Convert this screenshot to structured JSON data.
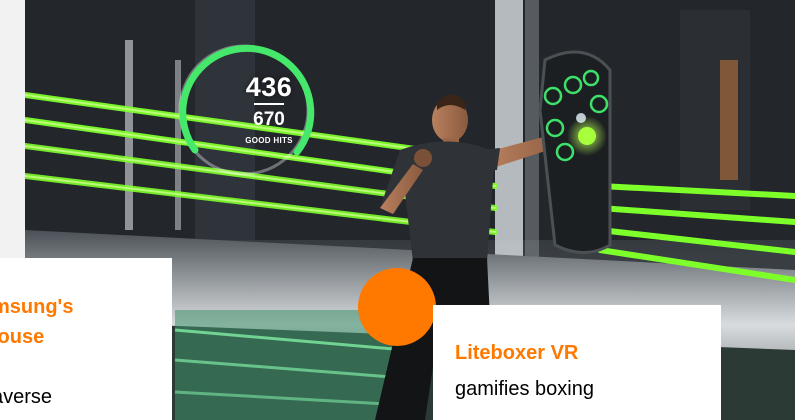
{
  "hud": {
    "good_hits": "436",
    "total_hits": "670",
    "caption": "GOOD HITS",
    "progress_fraction": 0.65
  },
  "cards": {
    "left": {
      "title_line1": "msung's",
      "title_line2": "louse",
      "body": "averse"
    },
    "right": {
      "title": "Liteboxer VR",
      "body": "gamifies boxing"
    }
  },
  "colors": {
    "accent": "#ff7900",
    "neon_green": "#7dff2a",
    "text": "#000000",
    "card_bg": "#ffffff"
  },
  "icons": {
    "dot": "orange-circle-icon",
    "target_pad": "punch-target-icon"
  }
}
